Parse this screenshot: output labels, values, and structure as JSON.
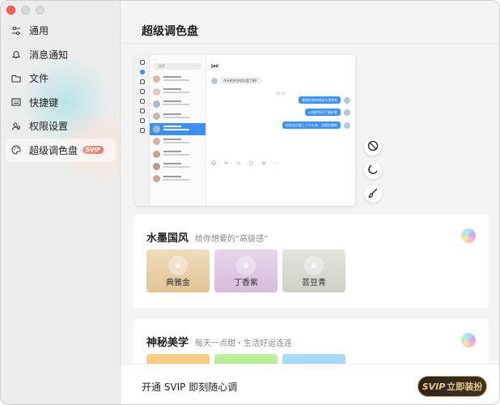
{
  "window": {
    "title": "超级调色盘"
  },
  "sidebar": {
    "items": [
      {
        "label": "通用",
        "icon": "sliders-icon"
      },
      {
        "label": "消息通知",
        "icon": "bell-icon"
      },
      {
        "label": "文件",
        "icon": "folder-icon"
      },
      {
        "label": "快捷键",
        "icon": "keyboard-icon"
      },
      {
        "label": "权限设置",
        "icon": "users-icon"
      },
      {
        "label": "超级调色盘",
        "icon": "palette-icon",
        "badge": "SVIP",
        "active": true
      }
    ]
  },
  "preview": {
    "search_placeholder": "搜索",
    "chat_title": "Jad",
    "incoming_message": "今天的天空也太蓝了吧！",
    "time": "09:30",
    "outgoing_messages": [
      "哪里的海岸线这么漂亮呀",
      "公园的花开了真好看",
      "你在这边看上了什么花，还挺好看的"
    ]
  },
  "side_buttons": [
    "ban-icon",
    "moon-icon",
    "brush-icon"
  ],
  "cards": [
    {
      "title": "水墨国风",
      "subtitle": "给你想要的“高级感”",
      "swatches": [
        {
          "label": "典雅金",
          "color": "#e8cfa6"
        },
        {
          "label": "丁香紫",
          "color": "#dcc6e2"
        },
        {
          "label": "芸豆青",
          "color": "#d6d7cf"
        }
      ]
    },
    {
      "title": "神秘美学",
      "subtitle": "每天一点甜・生活好运连连",
      "swatches": [
        {
          "label": "",
          "color": "#f7c27a"
        },
        {
          "label": "",
          "color": "#a4e48a"
        },
        {
          "label": "",
          "color": "#8fd2f5"
        }
      ]
    }
  ],
  "footer": {
    "text": "开通 SVIP 即刻随心调",
    "button_prefix": "SVIP",
    "button_label": "立即装扮"
  },
  "colors": {
    "accent": "#3d8ff2",
    "gold": "#c7a36a",
    "svip_badge": "#dd8b78"
  }
}
